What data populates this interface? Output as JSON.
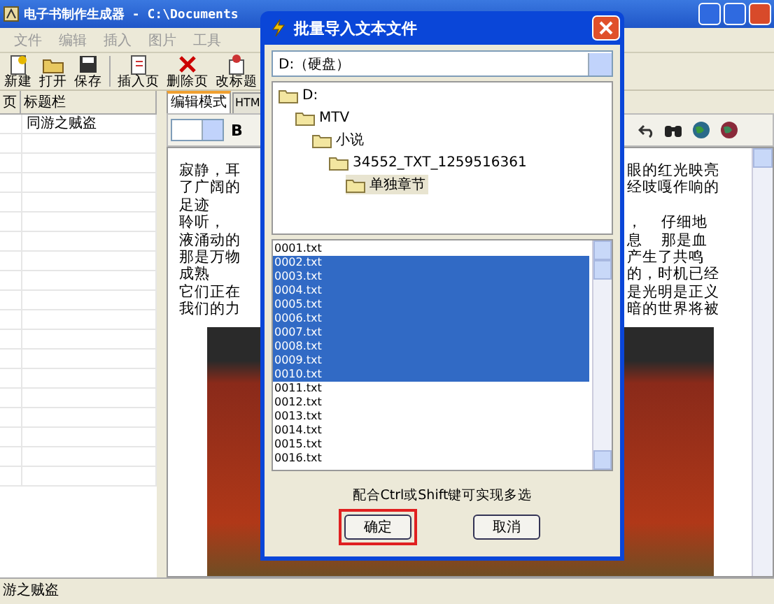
{
  "window": {
    "title": "电子书制作生成器 - C:\\Documents"
  },
  "menu": [
    "文件",
    "编辑",
    "插入",
    "图片",
    "工具"
  ],
  "toolbar": [
    {
      "label": "新建",
      "kind": "new"
    },
    {
      "label": "打开",
      "kind": "open"
    },
    {
      "label": "保存",
      "kind": "save"
    },
    {
      "label": "插入页",
      "kind": "insert"
    },
    {
      "label": "删除页",
      "kind": "delete"
    },
    {
      "label": "改标题",
      "kind": "rename"
    }
  ],
  "pages": {
    "columns": [
      "页",
      "标题栏"
    ],
    "rows": [
      {
        "title": "同游之贼盗",
        "selected": false
      }
    ]
  },
  "editor": {
    "tabs": [
      {
        "label": "编辑模式",
        "selected": true
      },
      {
        "label": "HTM",
        "selected": false
      }
    ],
    "bold": "B",
    "lines": [
      {
        "left": "寂静，耳",
        "right": "眼的红光映亮"
      },
      {
        "left": "了广阔的",
        "right": "经吱嘎作响的"
      },
      {
        "left": "足迹"
      },
      {
        "left": "聆听，",
        "right": "，    仔细地"
      },
      {
        "left": "液涌动的",
        "right": "息    那是血"
      },
      {
        "left": "那是万物",
        "right": "产生了共鸣"
      },
      {
        "left": "成熟",
        "right": "的，时机已经"
      },
      {
        "left": "它们正在",
        "right": "是光明是正义"
      },
      {
        "left": "我们的力",
        "right": "暗的世界将被"
      }
    ]
  },
  "dialog": {
    "title": "批量导入文本文件",
    "drive": "D:（硬盘）",
    "tree": [
      {
        "label": "D:",
        "selected": false,
        "children": [
          {
            "label": "MTV",
            "selected": false,
            "children": [
              {
                "label": "小说",
                "selected": false,
                "children": [
                  {
                    "label": "34552_TXT_1259516361",
                    "selected": false,
                    "children": [
                      {
                        "label": "单独章节",
                        "selected": true
                      }
                    ]
                  }
                ]
              }
            ]
          }
        ]
      }
    ],
    "files": [
      {
        "name": "0001.txt",
        "selected": false
      },
      {
        "name": "0002.txt",
        "selected": true
      },
      {
        "name": "0003.txt",
        "selected": true
      },
      {
        "name": "0004.txt",
        "selected": true
      },
      {
        "name": "0005.txt",
        "selected": true
      },
      {
        "name": "0006.txt",
        "selected": true
      },
      {
        "name": "0007.txt",
        "selected": true
      },
      {
        "name": "0008.txt",
        "selected": true
      },
      {
        "name": "0009.txt",
        "selected": true
      },
      {
        "name": "0010.txt",
        "selected": true
      },
      {
        "name": "0011.txt",
        "selected": false
      },
      {
        "name": "0012.txt",
        "selected": false
      },
      {
        "name": "0013.txt",
        "selected": false
      },
      {
        "name": "0014.txt",
        "selected": false
      },
      {
        "name": "0015.txt",
        "selected": false
      },
      {
        "name": "0016.txt",
        "selected": false
      }
    ],
    "hint": "配合Ctrl或Shift键可实现多选",
    "buttons": [
      {
        "label": "确定",
        "highlighted": true
      },
      {
        "label": "取消",
        "highlighted": false
      }
    ]
  },
  "status_bar": "游之贼盗"
}
